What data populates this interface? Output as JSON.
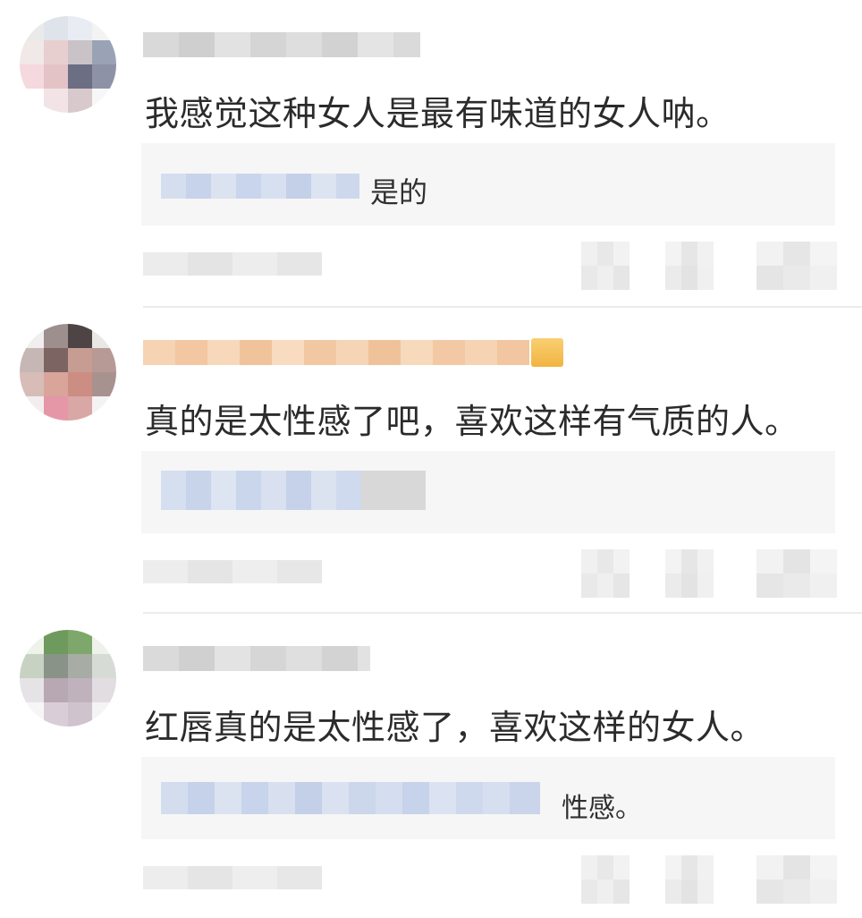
{
  "comments": [
    {
      "text": "我感觉这种女人是最有味道的女人呐。",
      "reply": {
        "text": "是的"
      }
    },
    {
      "text": "真的是太性感了吧，喜欢这样有气质的人。",
      "reply": {
        "text": ""
      }
    },
    {
      "text": "红唇真的是太性感了，喜欢这样的女人。",
      "reply": {
        "text": "性感。"
      }
    }
  ],
  "colors": {
    "text": "#2b2b2b",
    "reply_bg": "#f6f6f6",
    "divider": "#ececec",
    "username_blur_gray": "#d8d8d8",
    "username_blur_orange": "#f6cfa6",
    "reply_name_blur_blue": "#c9d6ec",
    "vip_badge": "#f2b441"
  }
}
